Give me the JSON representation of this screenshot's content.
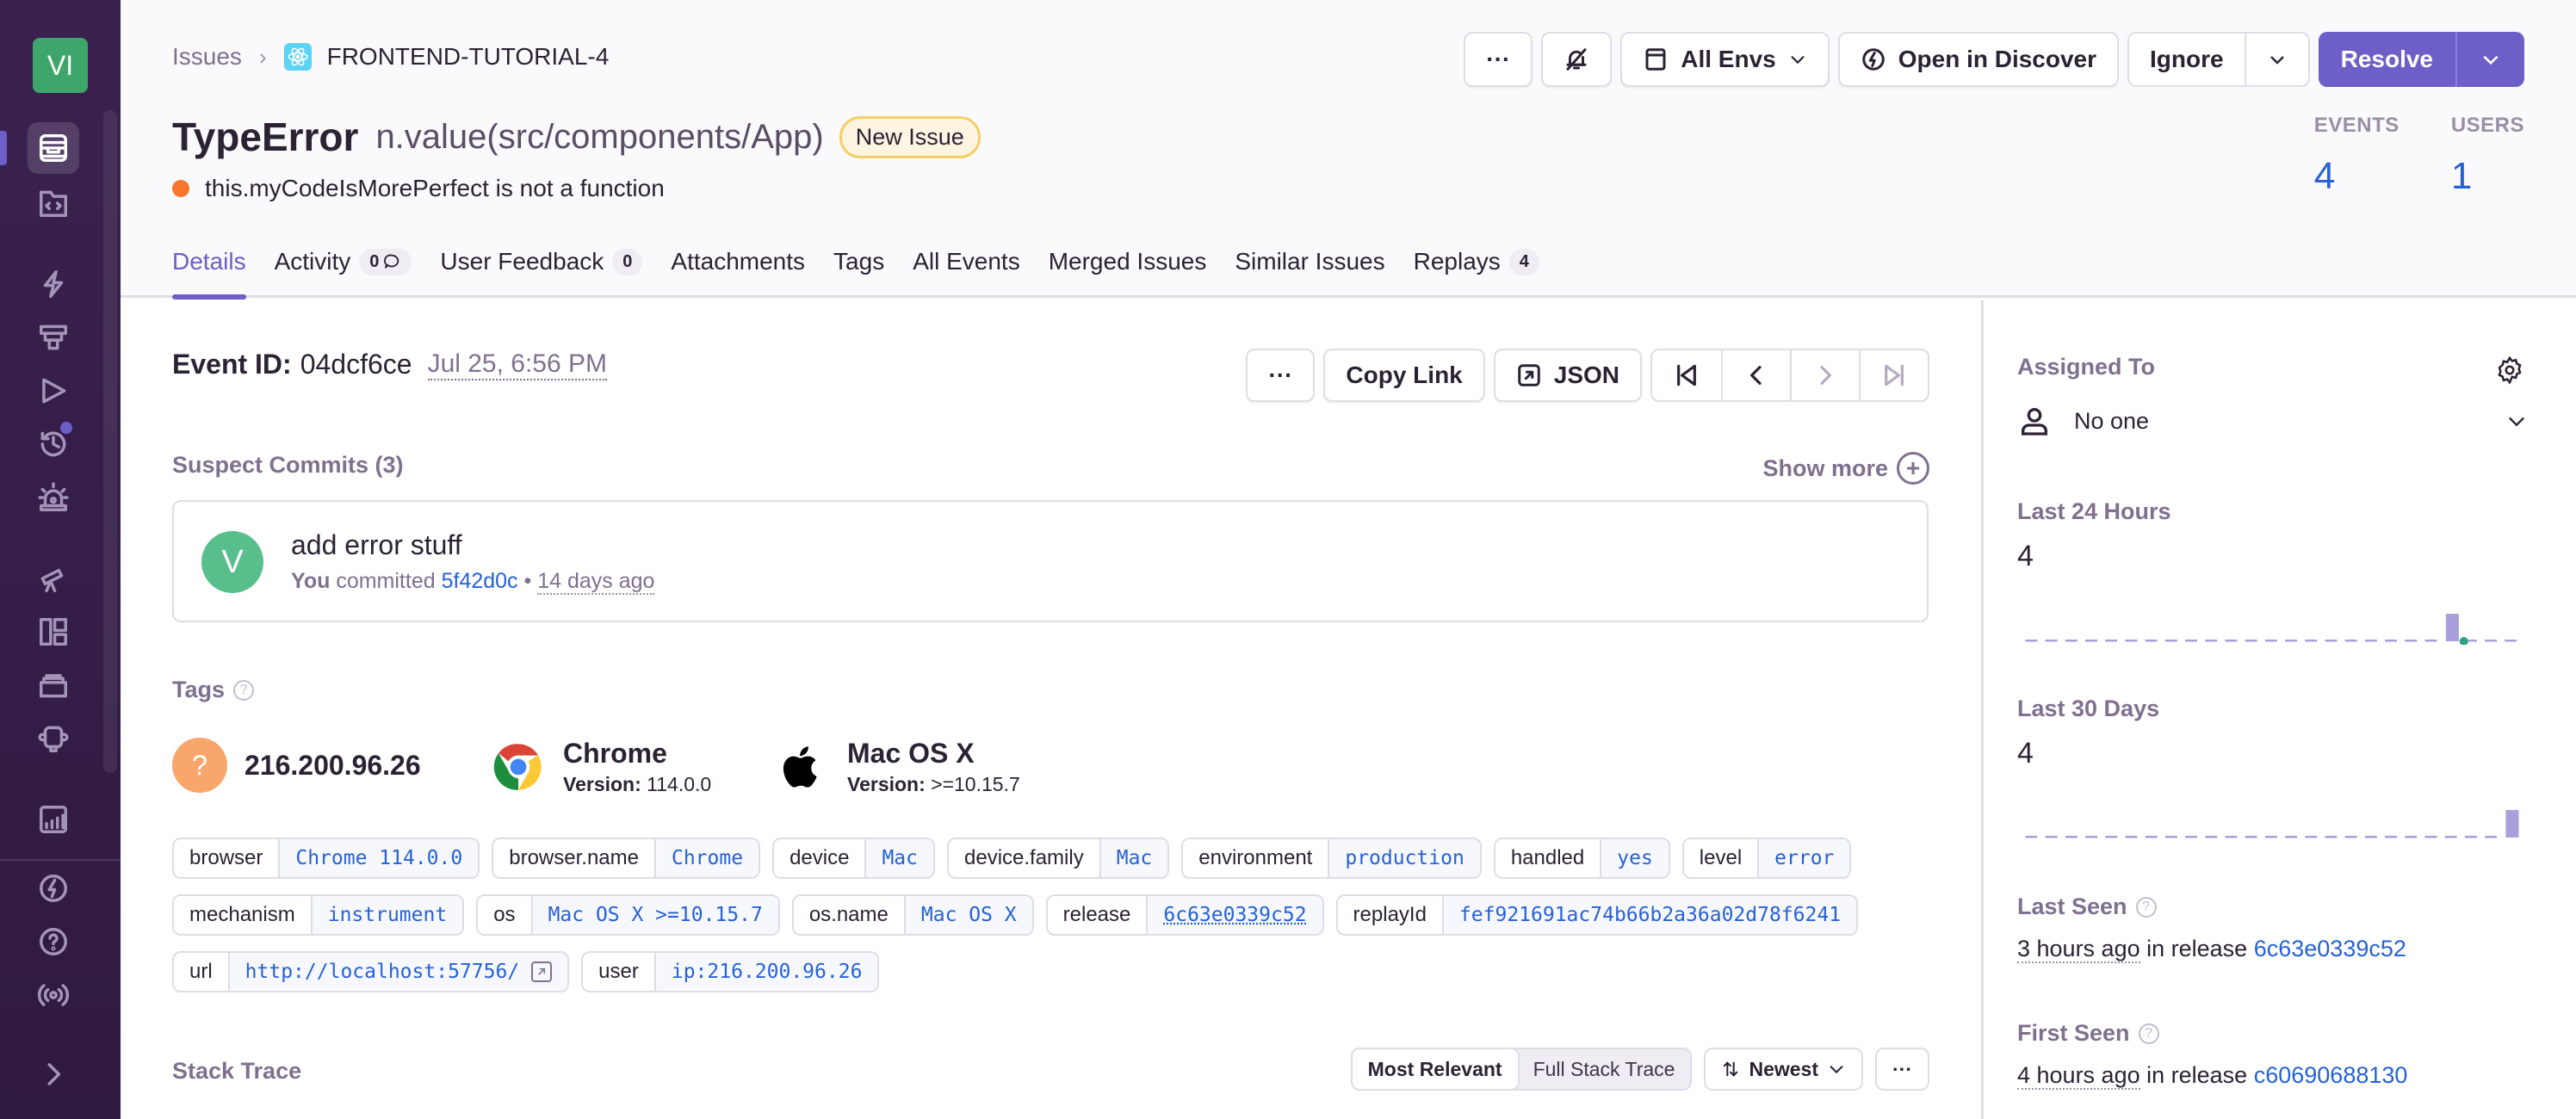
{
  "sidebar": {
    "org_initials": "VI",
    "top_items": [
      {
        "name": "issues-icon",
        "active": true
      },
      {
        "name": "projects-icon",
        "active": false
      },
      {
        "name": "performance-icon",
        "active": false
      },
      {
        "name": "profiling-icon",
        "active": false
      },
      {
        "name": "replays-icon",
        "active": false
      },
      {
        "name": "crons-icon",
        "active": false,
        "badge": true
      },
      {
        "name": "alerts-icon",
        "active": false
      },
      {
        "name": "discover-icon",
        "active": false
      },
      {
        "name": "dashboards-icon",
        "active": false
      },
      {
        "name": "releases-icon",
        "active": false
      },
      {
        "name": "user-feedback-icon",
        "active": false
      },
      {
        "name": "stats-icon",
        "active": false
      }
    ],
    "bottom_items": [
      {
        "name": "whats-new-icon"
      },
      {
        "name": "help-icon"
      },
      {
        "name": "broadcast-icon"
      },
      {
        "name": "collapse-icon"
      }
    ]
  },
  "header": {
    "breadcrumb": {
      "parent": "Issues",
      "current": "FRONTEND-TUTORIAL-4"
    },
    "title": {
      "type": "TypeError",
      "culprit": "n.value(src/components/App)",
      "badge": "New Issue"
    },
    "message": "this.myCodeIsMorePerfect is not a function",
    "level_color": "#f8762e",
    "actions": {
      "more_label": "···",
      "env_label": "All Envs",
      "discover_label": "Open in Discover",
      "ignore_label": "Ignore",
      "resolve_label": "Resolve"
    },
    "stats": [
      {
        "label": "EVENTS",
        "value": "4"
      },
      {
        "label": "USERS",
        "value": "1"
      }
    ],
    "tabs": [
      {
        "label": "Details",
        "active": true
      },
      {
        "label": "Activity",
        "count": "0",
        "comment_icon": true
      },
      {
        "label": "User Feedback",
        "count": "0"
      },
      {
        "label": "Attachments"
      },
      {
        "label": "Tags"
      },
      {
        "label": "All Events"
      },
      {
        "label": "Merged Issues"
      },
      {
        "label": "Similar Issues"
      },
      {
        "label": "Replays",
        "count": "4"
      }
    ]
  },
  "event": {
    "id_label": "Event ID:",
    "id": "04dcf6ce",
    "date": "Jul 25, 6:56 PM",
    "more_label": "···",
    "copy_link_label": "Copy Link",
    "json_label": "JSON"
  },
  "suspect_commits": {
    "title": "Suspect Commits (3)",
    "show_more": "Show more",
    "commit": {
      "avatar": "V",
      "message": "add error stuff",
      "author": "You",
      "verb": "committed",
      "hash": "5f42d0c",
      "sep": "•",
      "time": "14 days ago"
    }
  },
  "tags": {
    "title": "Tags",
    "summaries": [
      {
        "name": "216.200.96.26",
        "icon": "unknown-user-icon"
      },
      {
        "name": "Chrome",
        "version_label": "Version:",
        "version": "114.0.0",
        "icon": "chrome-icon"
      },
      {
        "name": "Mac OS X",
        "version_label": "Version:",
        "version": ">=10.15.7",
        "icon": "apple-icon"
      }
    ],
    "rows": [
      [
        {
          "key": "browser",
          "value": "Chrome 114.0.0"
        },
        {
          "key": "browser.name",
          "value": "Chrome"
        },
        {
          "key": "device",
          "value": "Mac"
        },
        {
          "key": "device.family",
          "value": "Mac"
        },
        {
          "key": "environment",
          "value": "production"
        },
        {
          "key": "handled",
          "value": "yes"
        },
        {
          "key": "level",
          "value": "error"
        }
      ],
      [
        {
          "key": "mechanism",
          "value": "instrument"
        },
        {
          "key": "os",
          "value": "Mac OS X >=10.15.7"
        },
        {
          "key": "os.name",
          "value": "Mac OS X"
        },
        {
          "key": "release",
          "value": "6c63e0339c52",
          "underline": true
        },
        {
          "key": "replayId",
          "value": "fef921691ac74b66b2a36a02d78f6241"
        }
      ],
      [
        {
          "key": "url",
          "value": "http://localhost:57756/",
          "external": true
        },
        {
          "key": "user",
          "value": "ip:216.200.96.26"
        }
      ]
    ]
  },
  "stack_trace": {
    "title": "Stack Trace",
    "toggle": [
      {
        "label": "Most Relevant",
        "active": true
      },
      {
        "label": "Full Stack Trace",
        "active": false
      }
    ],
    "sort_label": "Newest",
    "more_label": "···"
  },
  "right_panel": {
    "assigned_to_label": "Assigned To",
    "assignee": "No one",
    "last_24h": {
      "label": "Last 24 Hours",
      "count": "4"
    },
    "last_30d": {
      "label": "Last 30 Days",
      "count": "4"
    },
    "last_seen": {
      "label": "Last Seen",
      "time": "3 hours ago",
      "in_release": "in release",
      "release": "6c63e0339c52"
    },
    "first_seen": {
      "label": "First Seen",
      "time": "4 hours ago",
      "in_release": "in release",
      "release": "c60690688130"
    }
  },
  "chart_data": [
    {
      "type": "bar",
      "title": "Last 24 Hours",
      "categories": [
        "1",
        "2",
        "3",
        "4",
        "5",
        "6",
        "7",
        "8",
        "9",
        "10",
        "11",
        "12",
        "13",
        "14",
        "15",
        "16",
        "17",
        "18",
        "19",
        "20",
        "21",
        "22",
        "23",
        "24",
        "25"
      ],
      "values": [
        0,
        0,
        0,
        0,
        0,
        0,
        0,
        0,
        0,
        0,
        0,
        0,
        0,
        0,
        0,
        0,
        0,
        0,
        0,
        0,
        0,
        4,
        0,
        0,
        0
      ],
      "markers": [
        {
          "after_index": 21,
          "color": "#2ba185"
        }
      ],
      "color": "#a99fdb"
    },
    {
      "type": "bar",
      "title": "Last 30 Days",
      "categories": [
        "1",
        "2",
        "3",
        "4",
        "5",
        "6",
        "7",
        "8",
        "9",
        "10",
        "11",
        "12",
        "13",
        "14",
        "15",
        "16",
        "17",
        "18",
        "19",
        "20",
        "21",
        "22",
        "23",
        "24",
        "25"
      ],
      "values": [
        0,
        0,
        0,
        0,
        0,
        0,
        0,
        0,
        0,
        0,
        0,
        0,
        0,
        0,
        0,
        0,
        0,
        0,
        0,
        0,
        0,
        0,
        0,
        0,
        4
      ],
      "color": "#a99fdb"
    }
  ]
}
